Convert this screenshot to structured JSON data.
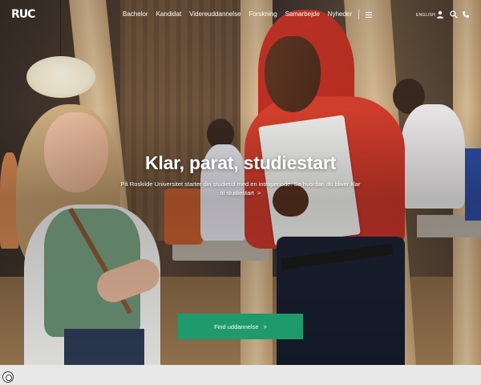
{
  "nav": {
    "logo": "RUC",
    "items": [
      {
        "label": "Bachelor"
      },
      {
        "label": "Kandidat"
      },
      {
        "label": "Videreuddannelse"
      },
      {
        "label": "Forskning"
      },
      {
        "label": "Samarbejde"
      },
      {
        "label": "Nyheder"
      }
    ],
    "language": "ENGLISH",
    "icons": [
      "menu-icon",
      "user-icon",
      "search-icon",
      "phone-icon"
    ]
  },
  "hero": {
    "title": "Klar, parat, studiestart",
    "subtitle": "På Roskilde Universitet starter din studietid med en introperiode. Se hvordan du bliver klar til studiestart",
    "subtitle_chevron": ">",
    "cta_label": "Find uddannelse",
    "cta_arrow": ">"
  },
  "colors": {
    "cta_background": "#1e9a6c",
    "nav_text": "#ffffff"
  },
  "footer": {
    "icons": [
      "cookie-icon"
    ]
  }
}
